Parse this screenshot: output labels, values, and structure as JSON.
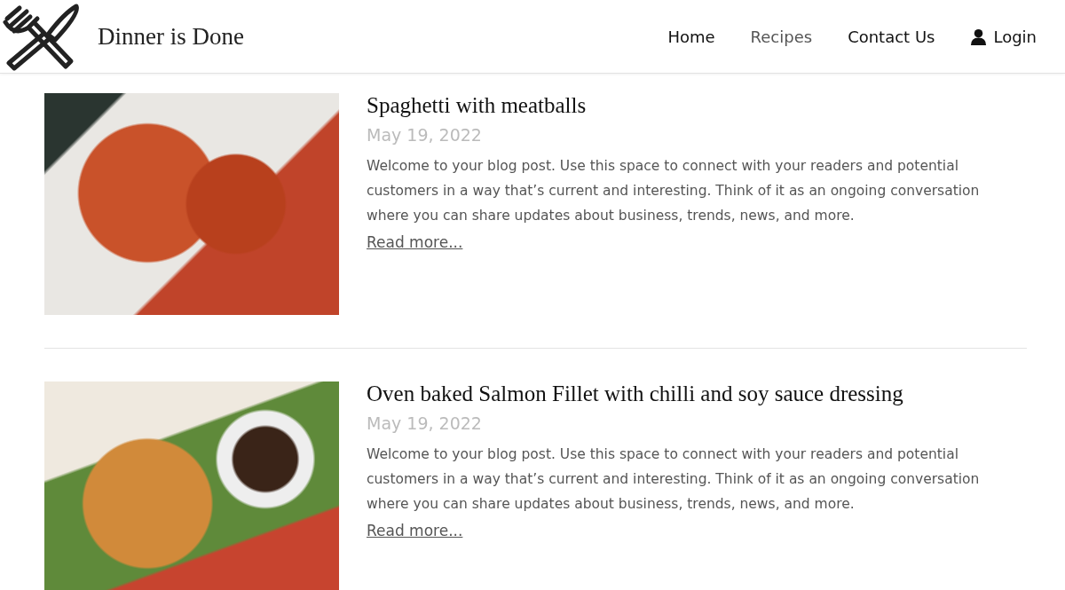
{
  "header": {
    "site_title": "Dinner is Done",
    "nav": [
      {
        "label": "Home",
        "selected": false
      },
      {
        "label": "Recipes",
        "selected": true
      },
      {
        "label": "Contact Us",
        "selected": false
      }
    ],
    "login": "Login"
  },
  "posts": [
    {
      "title": "Spaghetti with meatballs",
      "date": "May 19, 2022",
      "excerpt": "Welcome to your blog post. Use this space to connect with your readers and potential customers in a way that’s current and interesting. Think of it as an ongoing conversation where you can share updates about business, trends, news, and more.",
      "link": "Read more..."
    },
    {
      "title": "Oven baked Salmon Fillet with chilli and soy sauce dressing",
      "date": "May 19, 2022",
      "excerpt": "Welcome to your blog post. Use this space to connect with your readers and potential customers in a way that’s current and interesting. Think of it as an ongoing conversation where you can share updates about business, trends, news, and more.",
      "link": "Read more..."
    }
  ]
}
